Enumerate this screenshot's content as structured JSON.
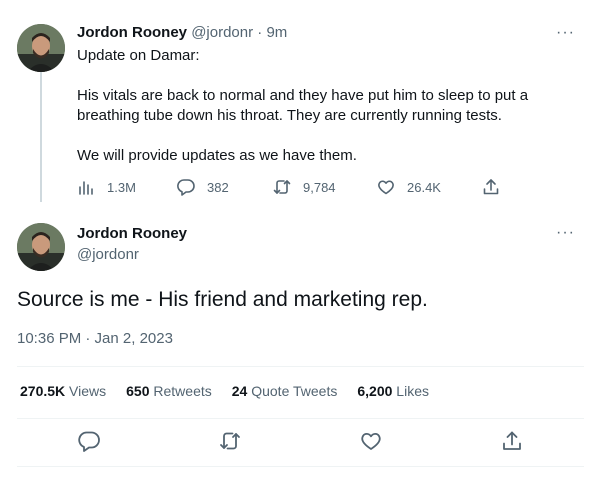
{
  "tweet1": {
    "name": "Jordon Rooney",
    "handle": "@jordonr",
    "separator": "·",
    "time": "9m",
    "more": "···",
    "body": [
      "Update on Damar:",
      "His vitals are back to normal and they have put him to sleep to put a breathing tube down his throat. They are currently running tests.",
      "We will provide updates as we have them."
    ],
    "actions": {
      "views": "1.3M",
      "replies": "382",
      "retweets": "9,784",
      "likes": "26.4K"
    }
  },
  "tweet2": {
    "name": "Jordon Rooney",
    "handle": "@jordonr",
    "more": "···",
    "text": "Source is me - His friend and marketing rep.",
    "timestamp": "10:36 PM · Jan 2, 2023",
    "stats": [
      {
        "value": "270.5K",
        "label": "Views"
      },
      {
        "value": "650",
        "label": "Retweets"
      },
      {
        "value": "24",
        "label": "Quote Tweets"
      },
      {
        "value": "6,200",
        "label": "Likes"
      }
    ]
  },
  "icons": {
    "views": "bar-chart-icon",
    "reply": "speech-bubble-icon",
    "retweet": "retweet-arrows-icon",
    "like": "heart-icon",
    "share": "share-upload-icon"
  },
  "colors": {
    "text": "#0f1419",
    "muted": "#536471",
    "thread_line": "#cfd9de",
    "divider": "#eff3f4"
  }
}
